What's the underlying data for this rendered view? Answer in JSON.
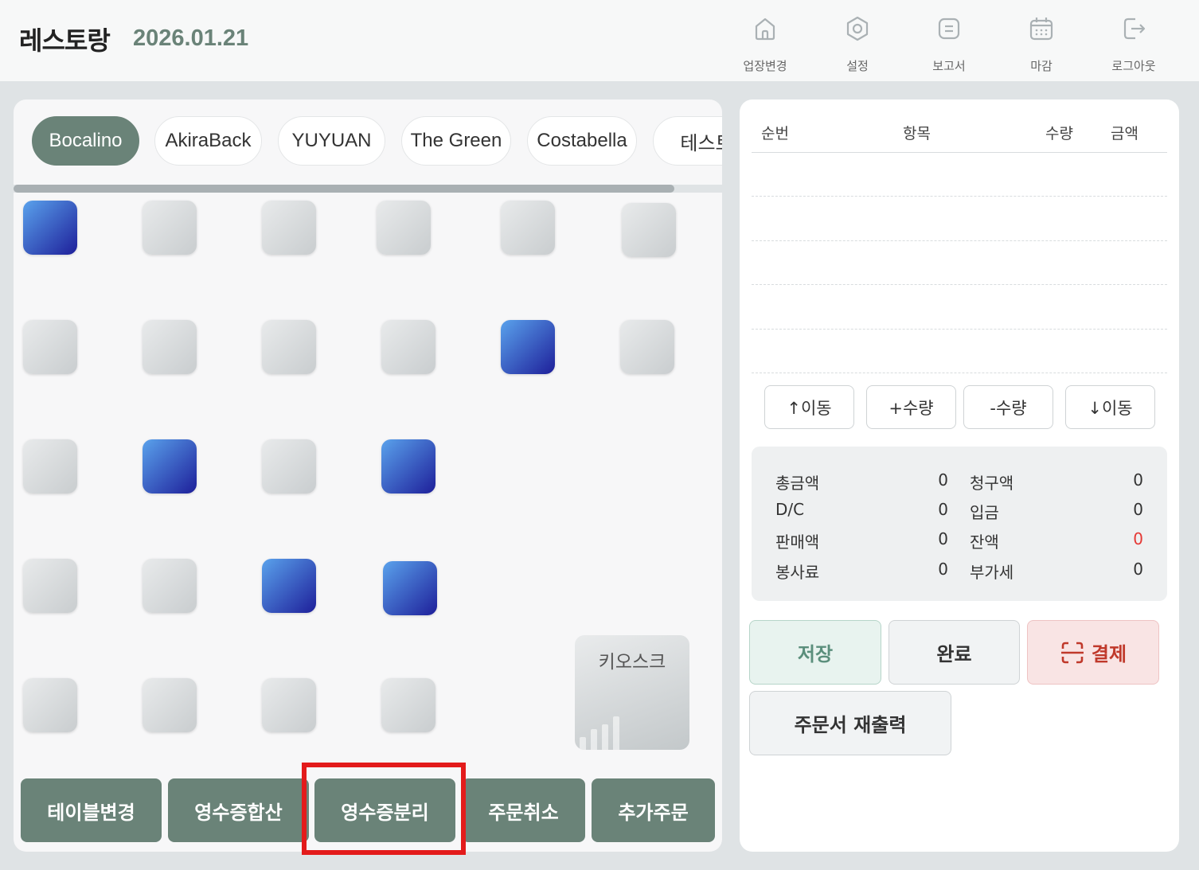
{
  "header": {
    "title": "레스토랑",
    "date": "2026.01.21",
    "nav": [
      {
        "label": "업장변경",
        "icon": "home-icon"
      },
      {
        "label": "설정",
        "icon": "settings-icon"
      },
      {
        "label": "보고서",
        "icon": "report-icon"
      },
      {
        "label": "마감",
        "icon": "calendar-icon"
      },
      {
        "label": "로그아웃",
        "icon": "logout-icon"
      }
    ]
  },
  "tabs": [
    "Bocalino",
    "AkiraBack",
    "YUYUAN",
    "The Green",
    "Costabella",
    "테스트"
  ],
  "active_tab": "Bocalino",
  "kiosk": {
    "label": "키오스크"
  },
  "bottom_actions": [
    "테이블변경",
    "영수증합산",
    "영수증분리",
    "주문취소",
    "추가주문"
  ],
  "order": {
    "columns": [
      "순번",
      "항목",
      "수량",
      "금액"
    ],
    "controls": [
      "↑이동",
      "+수량",
      "-수량",
      "↓이동"
    ]
  },
  "summary": {
    "total_label": "총금액",
    "total": "0",
    "billed_label": "청구액",
    "billed": "0",
    "dc_label": "D/C",
    "dc": "0",
    "deposit_label": "입금",
    "deposit": "0",
    "sales_label": "판매액",
    "sales": "0",
    "balance_label": "잔액",
    "balance": "0",
    "service_label": "봉사료",
    "service": "0",
    "vat_label": "부가세",
    "vat": "0",
    "balance_color": "#e53935"
  },
  "actions": {
    "save": "저장",
    "complete": "완료",
    "pay": "결제",
    "reprint": "주문서 재출력"
  },
  "colors": {
    "accent": "#6a8378",
    "occupied": "#2f55c9",
    "highlight": "#e31b1b"
  }
}
